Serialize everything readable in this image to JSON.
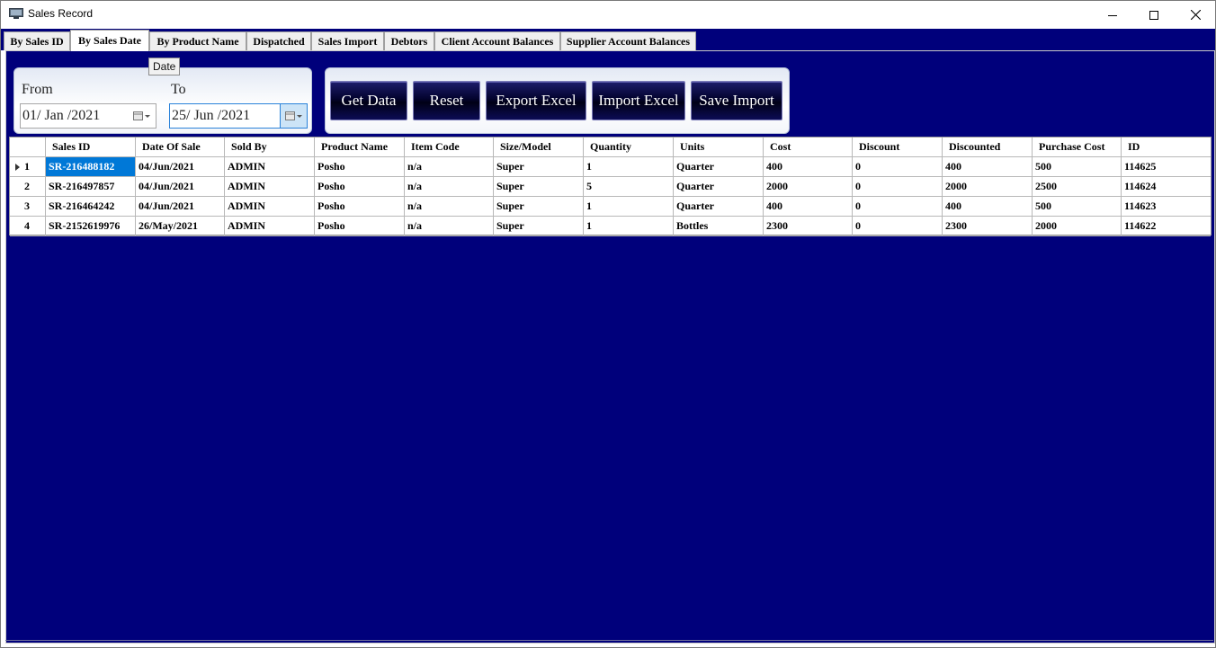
{
  "window": {
    "title": "Sales Record"
  },
  "tabs": [
    {
      "label": "By Sales ID"
    },
    {
      "label": "By Sales Date"
    },
    {
      "label": "By Product Name"
    },
    {
      "label": "Dispatched"
    },
    {
      "label": "Sales Import"
    },
    {
      "label": "Debtors"
    },
    {
      "label": "Client Account Balances"
    },
    {
      "label": "Supplier Account Balances"
    }
  ],
  "active_tab": "By Sales Date",
  "filter": {
    "from_label": "From",
    "to_label": "To",
    "from_value": "01/ Jan /2021",
    "to_value": "25/ Jun /2021",
    "tooltip": "Date"
  },
  "actions": {
    "get_data": "Get Data",
    "reset": "Reset",
    "export_excel": "Export Excel",
    "import_excel": "Import Excel",
    "save_import": "Save Import"
  },
  "table": {
    "columns": [
      "Sales ID",
      "Date Of Sale",
      "Sold By",
      "Product Name",
      "Item Code",
      "Size/Model",
      "Quantity",
      "Units",
      "Cost",
      "Discount",
      "Discounted",
      "Purchase Cost",
      "ID"
    ],
    "rows": [
      {
        "n": "1",
        "cells": [
          "SR-216488182",
          "04/Jun/2021",
          "ADMIN",
          "Posho",
          "n/a",
          "Super",
          "1",
          "Quarter",
          "400",
          "0",
          "400",
          "500",
          "114625"
        ]
      },
      {
        "n": "2",
        "cells": [
          "SR-216497857",
          "04/Jun/2021",
          "ADMIN",
          "Posho",
          "n/a",
          "Super",
          "5",
          "Quarter",
          "2000",
          "0",
          "2000",
          "2500",
          "114624"
        ]
      },
      {
        "n": "3",
        "cells": [
          "SR-216464242",
          "04/Jun/2021",
          "ADMIN",
          "Posho",
          "n/a",
          "Super",
          "1",
          "Quarter",
          "400",
          "0",
          "400",
          "500",
          "114623"
        ]
      },
      {
        "n": "4",
        "cells": [
          "SR-2152619976",
          "26/May/2021",
          "ADMIN",
          "Posho",
          "n/a",
          "Super",
          "1",
          "Bottles",
          "2300",
          "0",
          "2300",
          "2000",
          "114622"
        ]
      }
    ]
  },
  "colors": {
    "background": "#00007b",
    "selection": "#0078d7"
  }
}
